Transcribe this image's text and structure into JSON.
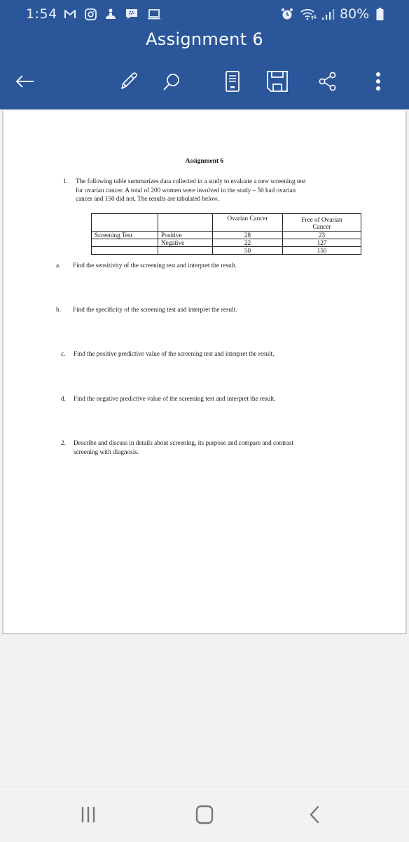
{
  "status_bar": {
    "time": "1:54",
    "battery_percent": "80%",
    "notification_icons": [
      "gmail-icon",
      "instagram-icon",
      "app-icon",
      "blackberry-messenger-icon",
      "laptop-icon"
    ],
    "system_icons": [
      "alarm-icon",
      "wifi-icon",
      "signal-icon",
      "battery-icon"
    ]
  },
  "app_bar": {
    "title": "Assignment 6",
    "back_icon": "arrow-left-icon",
    "actions": [
      "edit-icon",
      "search-icon",
      "reading-view-icon",
      "save-icon",
      "share-icon",
      "more-icon"
    ]
  },
  "document": {
    "title": "Assignment 6",
    "question1": {
      "number": "1.",
      "lines": [
        "The following table summarizes data collected in a study to evaluate a new screening test",
        "for ovarian cancer.  A total of 200 women were involved in the study – 50 had ovarian",
        "cancer and 150 did not.  The results are tabulated below."
      ]
    },
    "table": {
      "header": [
        "",
        "",
        "Ovarian Cancer",
        "Free of Ovarian Cancer"
      ],
      "rows": [
        [
          "Screening Test",
          "Positive",
          "28",
          "23"
        ],
        [
          "",
          "Negative",
          "22",
          "127"
        ],
        [
          "",
          "",
          "50",
          "150"
        ]
      ]
    },
    "subquestions": [
      {
        "label": "a.",
        "text": "Find the sensitivity of the screening test and interpret the result."
      },
      {
        "label": "b.",
        "text": "Find the specificity of the screening test and interpret the result."
      },
      {
        "label": "c.",
        "text": "Find the positive predictive value of the screening test and interpret the result."
      },
      {
        "label": "d.",
        "text": "Find the negative predictive value of the screening test and interpret the result."
      }
    ],
    "question2": {
      "number": "2.",
      "lines": [
        "Describe and discuss in details about screening, its purpose and compare and contrast",
        "screening with diagnosis."
      ]
    }
  },
  "nav_bar": {
    "buttons": [
      "recent-apps-icon",
      "home-icon",
      "back-icon"
    ]
  },
  "colors": {
    "app_bar": "#2b579a",
    "background": "#f2f2f2",
    "page": "#ffffff"
  }
}
